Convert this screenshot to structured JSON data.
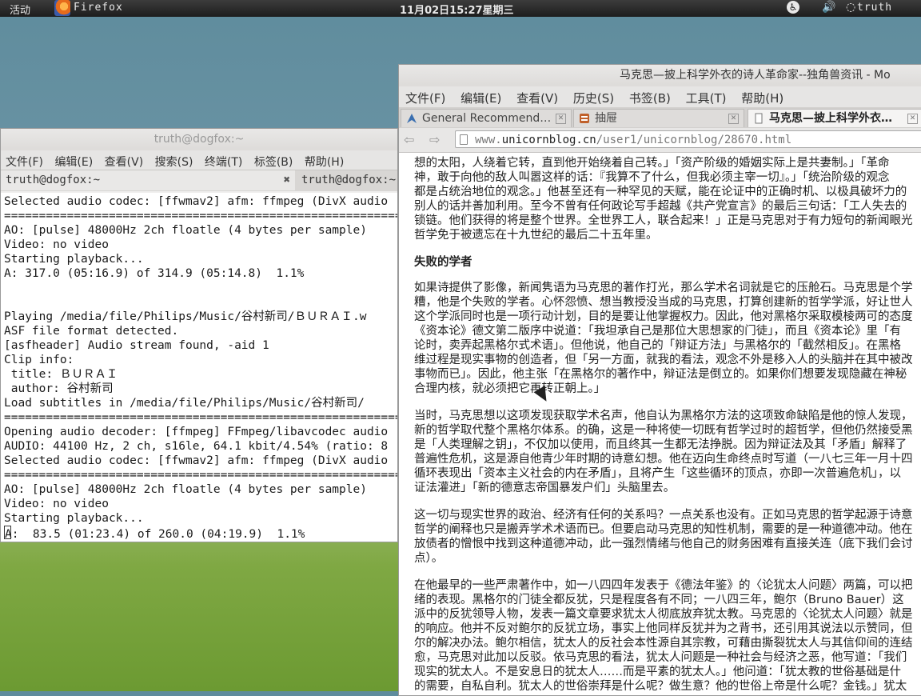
{
  "top_panel": {
    "activities": "活动",
    "app_name": "Firefox",
    "clock": "11月02日15:27星期三",
    "user": "truth"
  },
  "terminal": {
    "title": "truth@dogfox:~",
    "menu": [
      "文件(F)",
      "编辑(E)",
      "查看(V)",
      "搜索(S)",
      "终端(T)",
      "标签(B)",
      "帮助(H)"
    ],
    "tabs": [
      "truth@dogfox:~",
      "truth@dogfox:~"
    ],
    "lines": [
      "Selected audio codec: [ffwmav2] afm: ffmpeg (DivX audio",
      "==========================================================",
      "AO: [pulse] 48000Hz 2ch floatle (4 bytes per sample)",
      "Video: no video",
      "Starting playback...",
      "A: 317.0 (05:16.9) of 314.9 (05:14.8)  1.1%",
      "",
      "",
      "Playing /media/file/Philips/Music/谷村新司/ＢＵＲＡＩ.w",
      "ASF file format detected.",
      "[asfheader] Audio stream found, -aid 1",
      "Clip info:",
      " title: ＢＵＲＡＩ",
      " author: 谷村新司",
      "Load subtitles in /media/file/Philips/Music/谷村新司/",
      "==========================================================",
      "Opening audio decoder: [ffmpeg] FFmpeg/libavcodec audio",
      "AUDIO: 44100 Hz, 2 ch, s16le, 64.1 kbit/4.54% (ratio: 8",
      "Selected audio codec: [ffwmav2] afm: ffmpeg (DivX audio",
      "==========================================================",
      "AO: [pulse] 48000Hz 2ch floatle (4 bytes per sample)",
      "Video: no video",
      "Starting playback...",
      "A:  83.5 (01:23.4) of 260.0 (04:19.9)  1.1%"
    ]
  },
  "firefox": {
    "title": "马克思—披上科学外衣的诗人革命家--独角兽资讯 - Mo",
    "menu": [
      "文件(F)",
      "编辑(E)",
      "查看(V)",
      "历史(S)",
      "书签(B)",
      "工具(T)",
      "帮助(H)"
    ],
    "tabs": [
      "General Recommend…",
      "抽屉",
      "马克思—披上科学外衣…"
    ],
    "url_prefix": "www.",
    "url_domain": "unicornblog.cn",
    "url_path": "/user1/unicornblog/28670.html",
    "article": {
      "p1": [
        "想的太阳，人绕着它转，直到他开始绕着自己转。」「资产阶级的婚姻实际上是共妻制。」「革命",
        "神，敢于向他的敌人叫嚣这样的话：『我算不了什么，但我必须主宰一切』。」「统治阶级的观念",
        "都是占统治地位的观念。」他甚至还有一种罕见的天赋，能在论证中的正确时机、以极具破坏力的",
        "别人的话并善加利用。至今不曾有任何政论写手超越《共产党宣言》的最后三句话：「工人失去的",
        "锁链。他们获得的将是整个世界。全世界工人，联合起来！」正是马克思对于有力短句的新闻眼光",
        "哲学免于被遗忘在十九世纪的最后二十五年里。"
      ],
      "heading": "失败的学者",
      "p2": [
        "如果诗提供了影像，新闻隽语为马克思的著作打光，那么学术名词就是它的压舱石。马克思是个学",
        "糟，他是个失败的学者。心怀怨愤、想当教授没当成的马克思，打算创建新的哲学学派，好让世人",
        "这个学派同时也是一项行动计划，目的是要让他掌握权力。因此，他对黑格尔采取模棱两可的态度",
        "《资本论》德文第二版序中说道：「我坦承自己是那位大思想家的门徒」，而且《资本论》里「有",
        "论时，卖弄起黑格尔式术语」。但他说，他自己的「辩证方法」与黑格尔的「截然相反」。在黑格",
        "维过程是现实事物的创造者，但「另一方面，就我的看法，观念不外是移入人的头脑并在其中被改",
        "事物而已」。因此，他主张「在黑格尔的著作中，辩证法是倒立的。如果你们想要发现隐藏在神秘",
        "合理内核，就必须把它再转正朝上。」"
      ],
      "p3": [
        "当时，马克思想以这项发现获取学术名声，他自认为黑格尔方法的这项致命缺陷是他的惊人发现，",
        "新的哲学取代整个黑格尔体系。的确，这是一种将使一切既有哲学过时的超哲学，但他仍然接受黑",
        "是「人类理解之钥」，不仅加以使用，而且终其一生都无法挣脱。因为辩证法及其「矛盾」解释了",
        "普遍性危机，这是源自他青少年时期的诗意幻想。他在迈向生命终点时写道（一八七三年一月十四",
        "循环表现出「资本主义社会的内在矛盾」，且将产生「这些循环的顶点，亦即一次普遍危机」，以",
        "证法灌进」「新的德意志帝国暴发户们」头脑里去。"
      ],
      "p4": [
        "这一切与现实世界的政治、经济有任何的关系吗？一点关系也没有。正如马克思的哲学起源于诗意",
        "哲学的阐释也只是搬弄学术术语而已。但要启动马克思的知性机制，需要的是一种道德冲动。他在",
        "放债者的憎恨中找到这种道德冲动，此一强烈情绪与他自己的财务困难有直接关连（底下我们会讨",
        "点）。"
      ],
      "p5": [
        "在他最早的一些严肃著作中，如一八四四年发表于《德法年鉴》的〈论犹太人问题〉两篇，可以把",
        "绪的表现。黑格尔的门徒全都反犹，只是程度各有不同；一八四三年，鲍尔（Bruno Bauer）这",
        "派中的反犹领导人物，发表一篇文章要求犹太人彻底放弃犹太教。马克思的〈论犹太人问题〉就是",
        "的响应。他并不反对鲍尔的反犹立场，事实上他同样反犹并为之背书，还引用其说法以示赞同，但",
        "尔的解决办法。鲍尔相信，犹太人的反社会本性源自其宗教，可藉由撕裂犹太人与其信仰间的连结",
        "愈，马克思对此加以反驳。依马克思的看法，犹太人问题是一种社会与经济之恶，他写道：「我们",
        "现实的犹太人。不是安息日的犹太人……而是平素的犹太人。」他问道：「犹太教的世俗基础是什",
        "的需要，自私自利。犹太人的世俗崇拜是什么呢？做生意？他的世俗上帝是什么呢？金钱。」犹太"
      ]
    }
  }
}
